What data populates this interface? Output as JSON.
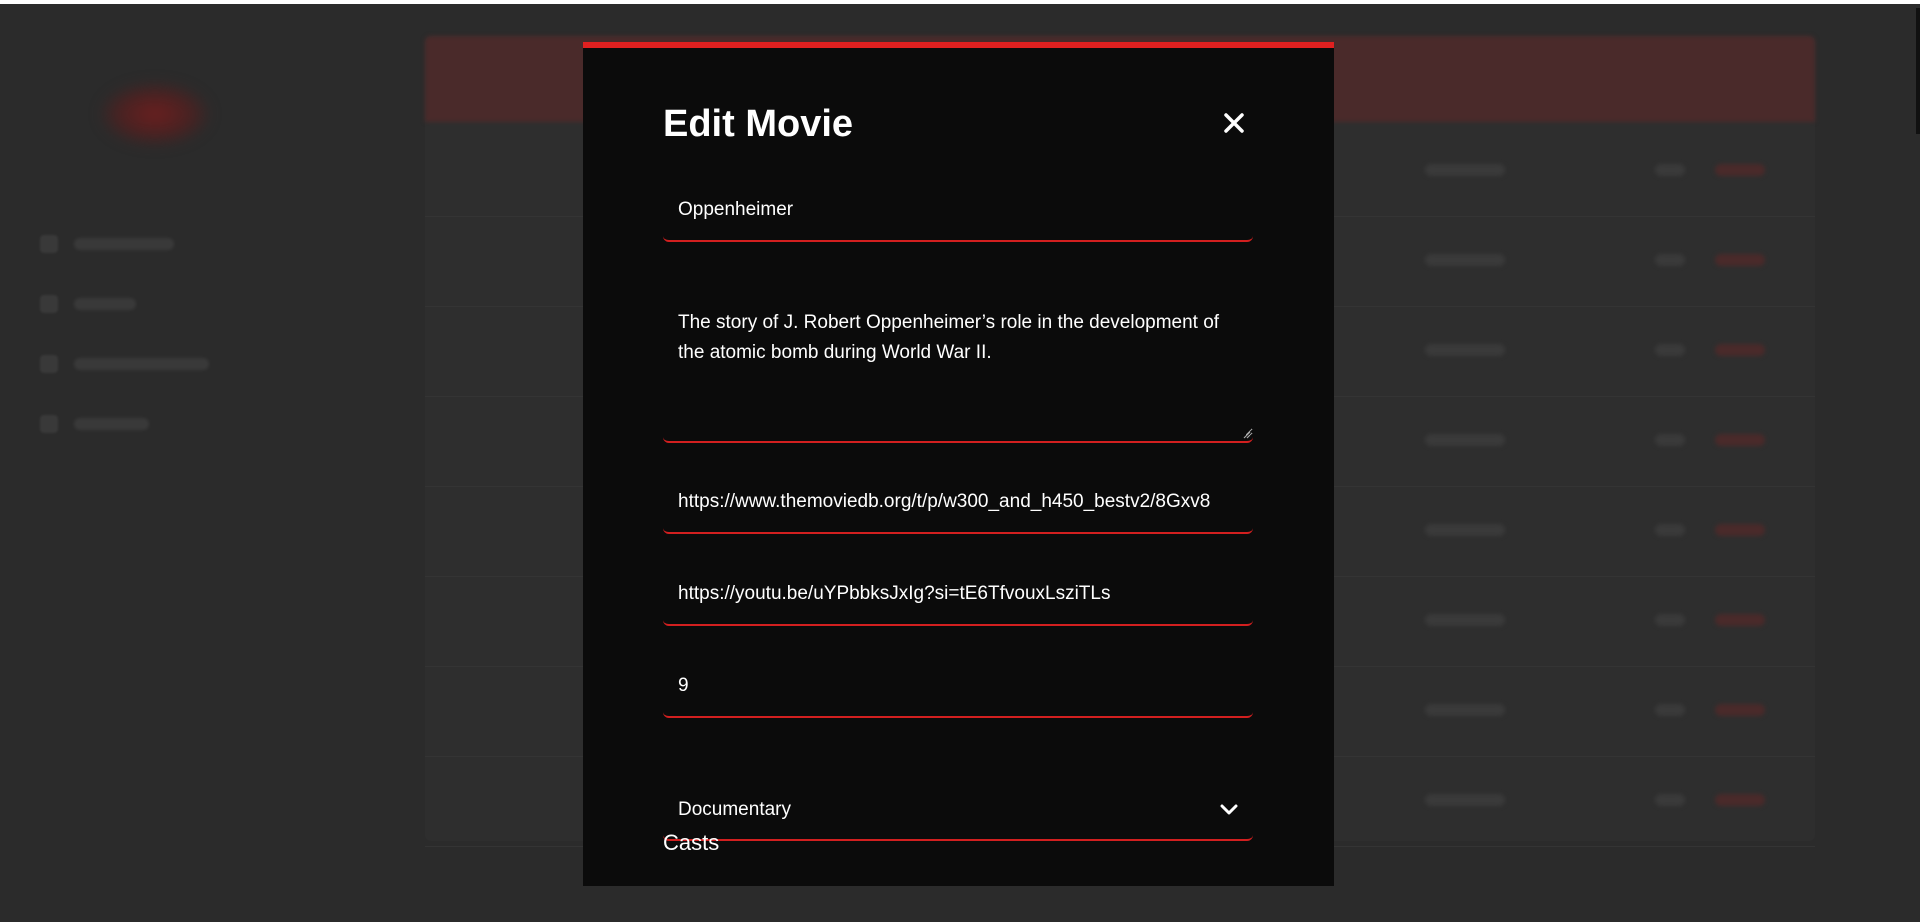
{
  "modal": {
    "title": "Edit Movie",
    "close_icon": "close-icon",
    "accent_color": "#e02020",
    "fields": {
      "title": "Oppenheimer",
      "description": "The story of J. Robert Oppenheimer’s role in the development of the atomic bomb during World War II.",
      "poster_url": "https://www.themoviedb.org/t/p/w300_and_h450_bestv2/8Gxv8",
      "trailer_url": "https://youtu.be/uYPbbksJxIg?si=tE6TfvouxLsziTLs",
      "rating": "9",
      "genre": "Documentary"
    },
    "casts_label": "Casts"
  }
}
